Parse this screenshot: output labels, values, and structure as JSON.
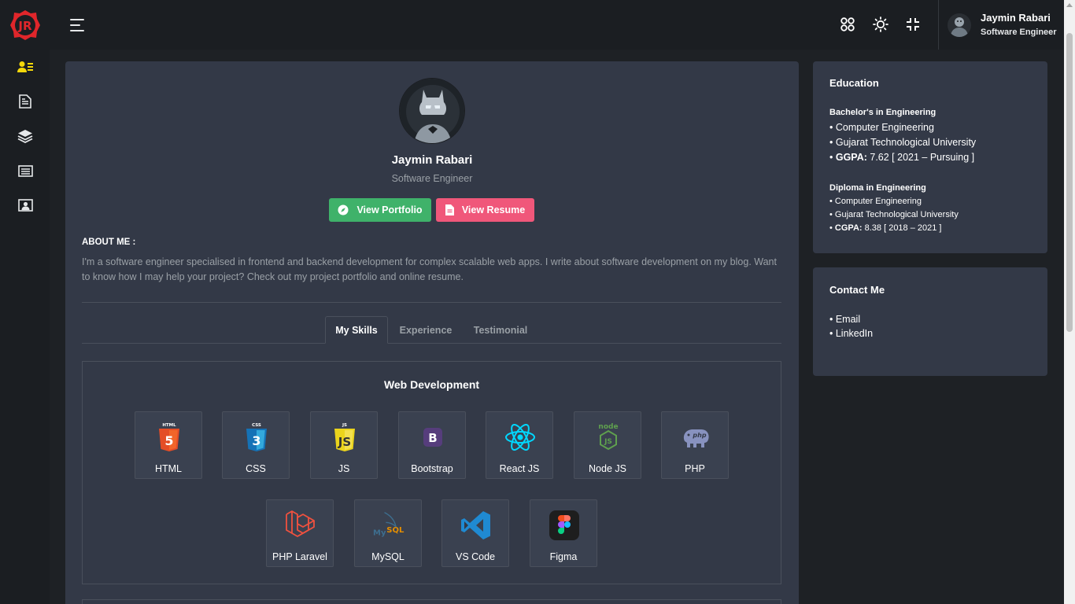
{
  "app": {
    "logo_text": "JR"
  },
  "sidebar": {
    "items": [
      {
        "name": "about",
        "icon": "user-card-icon",
        "active": true
      },
      {
        "name": "resume",
        "icon": "document-icon"
      },
      {
        "name": "projects",
        "icon": "layers-icon"
      },
      {
        "name": "blog",
        "icon": "list-icon"
      },
      {
        "name": "contact",
        "icon": "contact-card-icon"
      }
    ]
  },
  "header": {
    "menu_icon": "hamburger-icon",
    "actions": [
      "apps-grid-icon",
      "theme-sun-icon",
      "exit-fullscreen-icon"
    ],
    "user": {
      "name": "Jaymin Rabari",
      "role": "Software Engineer"
    }
  },
  "profile": {
    "name": "Jaymin Rabari",
    "role": "Software Engineer",
    "buttons": {
      "portfolio": "View Portfolio",
      "resume": "View Resume"
    },
    "about_title": "ABOUT ME :",
    "about_text": "I'm a software engineer specialised in frontend and backend development for complex scalable web apps. I write about software development on my blog. Want to know how I may help your project? Check out my project portfolio and online resume."
  },
  "tabs": [
    {
      "label": "My Skills",
      "active": true
    },
    {
      "label": "Experience"
    },
    {
      "label": "Testimonial"
    }
  ],
  "skills": {
    "title": "Web Development",
    "items": [
      {
        "label": "HTML",
        "icon": "html5-icon"
      },
      {
        "label": "CSS",
        "icon": "css3-icon"
      },
      {
        "label": "JS",
        "icon": "javascript-icon"
      },
      {
        "label": "Bootstrap",
        "icon": "bootstrap-icon"
      },
      {
        "label": "React JS",
        "icon": "react-icon"
      },
      {
        "label": "Node JS",
        "icon": "nodejs-icon"
      },
      {
        "label": "PHP",
        "icon": "php-icon"
      },
      {
        "label": "PHP Laravel",
        "icon": "laravel-icon"
      },
      {
        "label": "MySQL",
        "icon": "mysql-icon"
      },
      {
        "label": "VS Code",
        "icon": "vscode-icon"
      },
      {
        "label": "Figma",
        "icon": "figma-icon"
      }
    ]
  },
  "education": {
    "title": "Education",
    "degrees": [
      {
        "heading": "Bachelor's in Engineering",
        "branch": "• Computer Engineering",
        "university": "• Gujarat Technological University",
        "grade_label": "GGPA:",
        "grade_value": " 7.62 [ 2021 – Pursuing ]",
        "bullet": "• "
      },
      {
        "heading": "Diploma in Engineering",
        "branch": "• Computer Engineering",
        "university": "• Gujarat Technological University",
        "grade_label": "CGPA:",
        "grade_value": " 8.38 [ 2018 – 2021 ]",
        "bullet": "• "
      }
    ]
  },
  "contact": {
    "title": "Contact Me",
    "links": [
      "• Email",
      "• LinkedIn"
    ]
  },
  "colors": {
    "background": "#1e2125",
    "card": "#333947",
    "portfolio_button": "#3fb26a",
    "resume_button": "#f0577a",
    "accent_active": "#f5d90a",
    "logo": "#e0262b"
  }
}
